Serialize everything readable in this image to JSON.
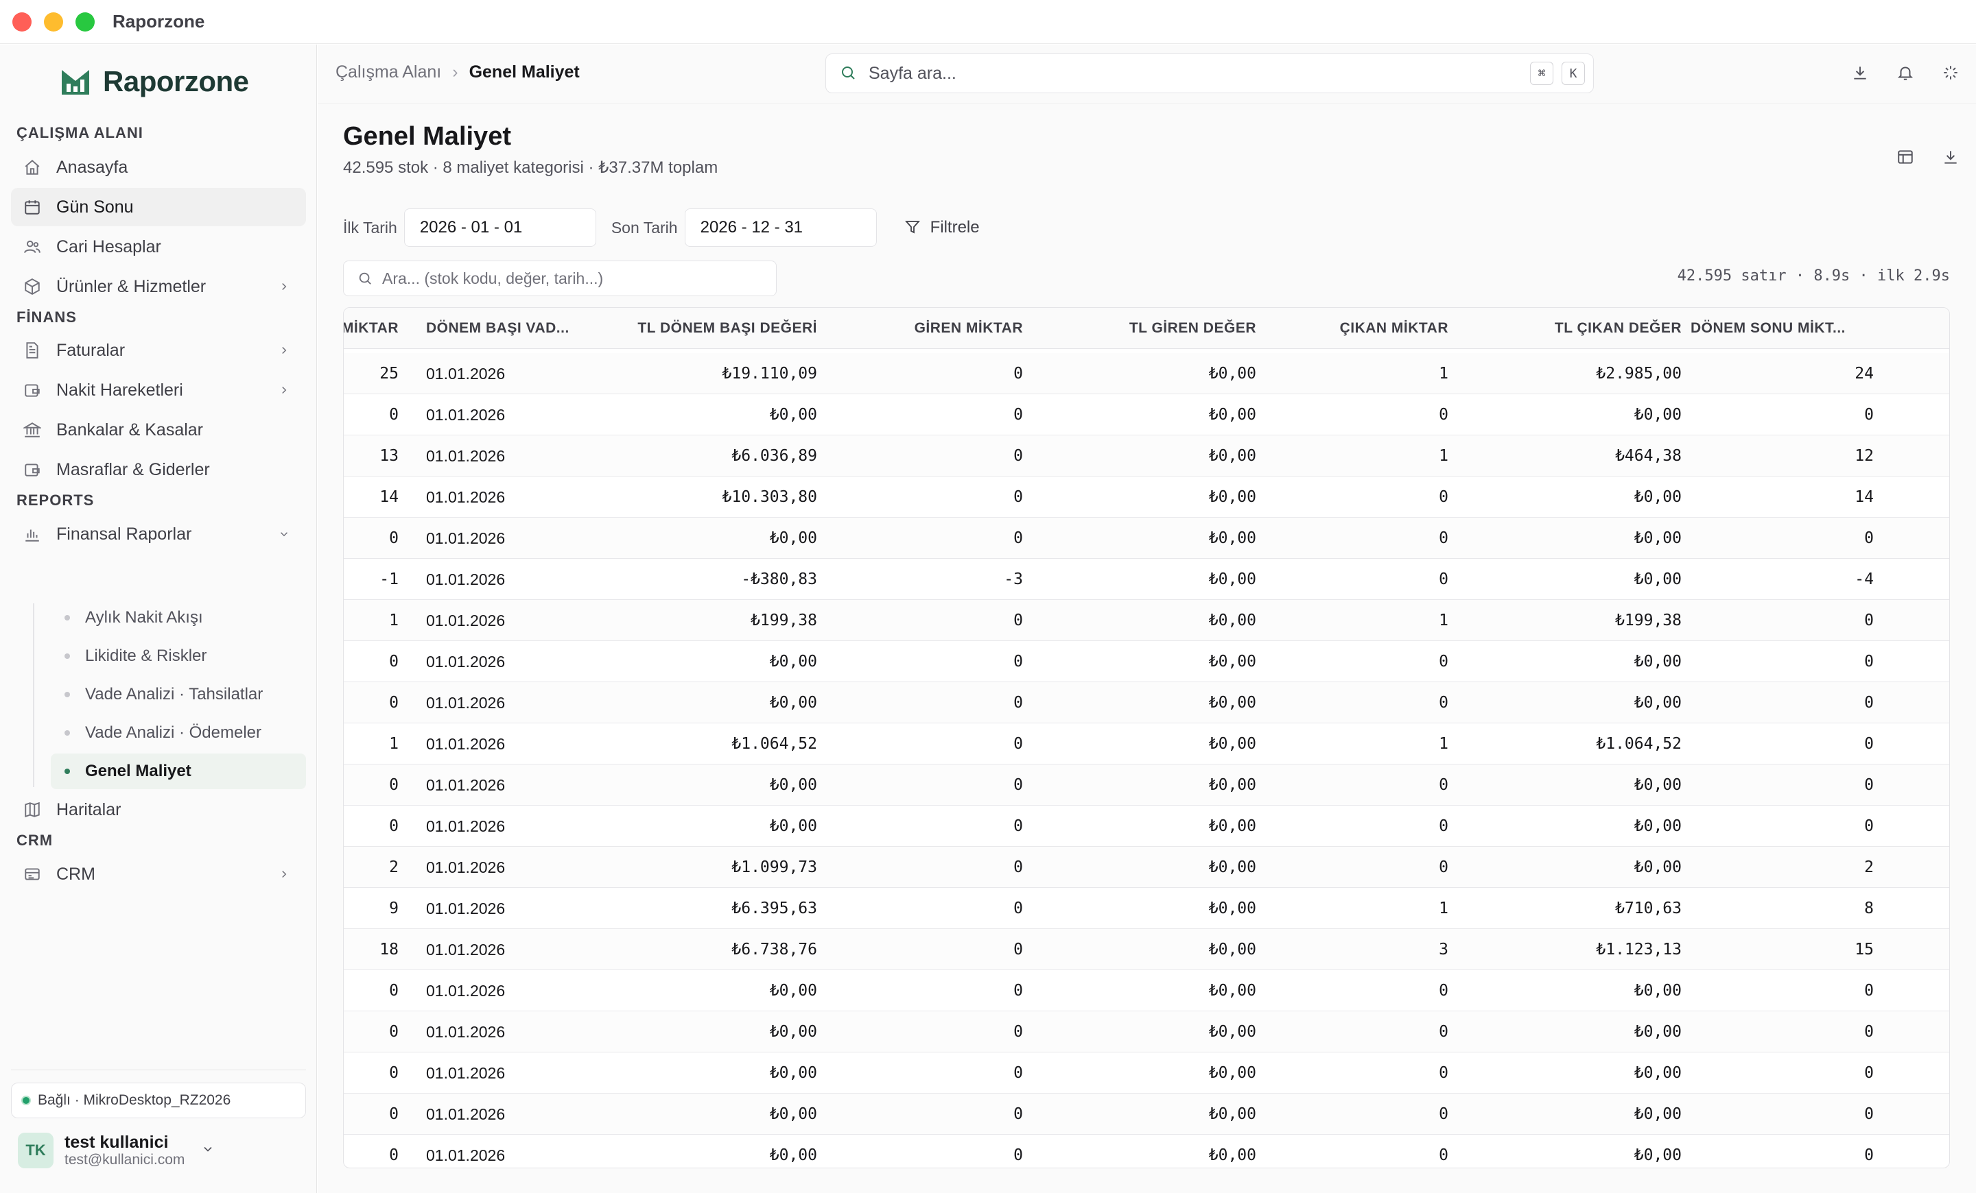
{
  "app": {
    "title": "Raporzone",
    "logo_text": "Raporzone"
  },
  "sidebar": {
    "sections": {
      "workspace": "ÇALIŞMA ALANI",
      "finance": "FİNANS",
      "reports": "REPORTS",
      "crm": "CRM"
    },
    "items": {
      "home": "Anasayfa",
      "day_end": "Gün Sonu",
      "accounts": "Cari Hesaplar",
      "products": "Ürünler & Hizmetler",
      "invoices": "Faturalar",
      "cash": "Nakit Hareketleri",
      "banks": "Bankalar & Kasalar",
      "expenses": "Masraflar & Giderler",
      "fin_reports": "Finansal Raporlar",
      "maps": "Haritalar",
      "crm": "CRM"
    },
    "sub_items": [
      "Aylık Nakit Akışı",
      "Likidite & Riskler",
      "Vade Analizi · Tahsilatlar",
      "Vade Analizi · Ödemeler",
      "Genel Maliyet"
    ],
    "connection": "Bağlı · MikroDesktop_RZ2026",
    "user": {
      "initials": "TK",
      "name": "test kullanici",
      "email": "test@kullanici.com"
    }
  },
  "topbar": {
    "breadcrumb_root": "Çalışma Alanı",
    "breadcrumb_sep": "›",
    "breadcrumb_current": "Genel Maliyet",
    "search_placeholder": "Sayfa ara...",
    "kbd_1": "⌘",
    "kbd_2": "K"
  },
  "page": {
    "title": "Genel Maliyet",
    "subtitle": "42.595 stok · 8 maliyet kategorisi · ₺37.37M toplam",
    "filters": {
      "start_label": "İlk Tarih",
      "start_value": "2026 - 01 - 01",
      "end_label": "Son Tarih",
      "end_value": "2026 - 12 - 31",
      "filter_button": "Filtrele"
    },
    "table_search_placeholder": "Ara... (stok kodu, değer, tarih...)",
    "stats": "42.595 satır · 8.9s · ilk 2.9s"
  },
  "table": {
    "columns": [
      "MİKTAR",
      "DÖNEM BAŞI VAD...",
      "TL DÖNEM BAŞI DEĞERİ",
      "GİREN MİKTAR",
      "TL GİREN DEĞER",
      "ÇIKAN MİKTAR",
      "TL ÇIKAN DEĞER",
      "DÖNEM SONU MİKT..."
    ],
    "rows": [
      [
        "25",
        "01.01.2026",
        "₺19.110,09",
        "0",
        "₺0,00",
        "1",
        "₺2.985,00",
        "24"
      ],
      [
        "0",
        "01.01.2026",
        "₺0,00",
        "0",
        "₺0,00",
        "0",
        "₺0,00",
        "0"
      ],
      [
        "13",
        "01.01.2026",
        "₺6.036,89",
        "0",
        "₺0,00",
        "1",
        "₺464,38",
        "12"
      ],
      [
        "14",
        "01.01.2026",
        "₺10.303,80",
        "0",
        "₺0,00",
        "0",
        "₺0,00",
        "14"
      ],
      [
        "0",
        "01.01.2026",
        "₺0,00",
        "0",
        "₺0,00",
        "0",
        "₺0,00",
        "0"
      ],
      [
        "-1",
        "01.01.2026",
        "-₺380,83",
        "-3",
        "₺0,00",
        "0",
        "₺0,00",
        "-4"
      ],
      [
        "1",
        "01.01.2026",
        "₺199,38",
        "0",
        "₺0,00",
        "1",
        "₺199,38",
        "0"
      ],
      [
        "0",
        "01.01.2026",
        "₺0,00",
        "0",
        "₺0,00",
        "0",
        "₺0,00",
        "0"
      ],
      [
        "0",
        "01.01.2026",
        "₺0,00",
        "0",
        "₺0,00",
        "0",
        "₺0,00",
        "0"
      ],
      [
        "1",
        "01.01.2026",
        "₺1.064,52",
        "0",
        "₺0,00",
        "1",
        "₺1.064,52",
        "0"
      ],
      [
        "0",
        "01.01.2026",
        "₺0,00",
        "0",
        "₺0,00",
        "0",
        "₺0,00",
        "0"
      ],
      [
        "0",
        "01.01.2026",
        "₺0,00",
        "0",
        "₺0,00",
        "0",
        "₺0,00",
        "0"
      ],
      [
        "2",
        "01.01.2026",
        "₺1.099,73",
        "0",
        "₺0,00",
        "0",
        "₺0,00",
        "2"
      ],
      [
        "9",
        "01.01.2026",
        "₺6.395,63",
        "0",
        "₺0,00",
        "1",
        "₺710,63",
        "8"
      ],
      [
        "18",
        "01.01.2026",
        "₺6.738,76",
        "0",
        "₺0,00",
        "3",
        "₺1.123,13",
        "15"
      ],
      [
        "0",
        "01.01.2026",
        "₺0,00",
        "0",
        "₺0,00",
        "0",
        "₺0,00",
        "0"
      ],
      [
        "0",
        "01.01.2026",
        "₺0,00",
        "0",
        "₺0,00",
        "0",
        "₺0,00",
        "0"
      ],
      [
        "0",
        "01.01.2026",
        "₺0,00",
        "0",
        "₺0,00",
        "0",
        "₺0,00",
        "0"
      ],
      [
        "0",
        "01.01.2026",
        "₺0,00",
        "0",
        "₺0,00",
        "0",
        "₺0,00",
        "0"
      ],
      [
        "0",
        "01.01.2026",
        "₺0,00",
        "0",
        "₺0,00",
        "0",
        "₺0,00",
        "0"
      ]
    ]
  },
  "colors": {
    "accent": "#2f7d5b",
    "traffic_red": "#ff5f57",
    "traffic_yellow": "#febc2e",
    "traffic_green": "#28c840"
  }
}
